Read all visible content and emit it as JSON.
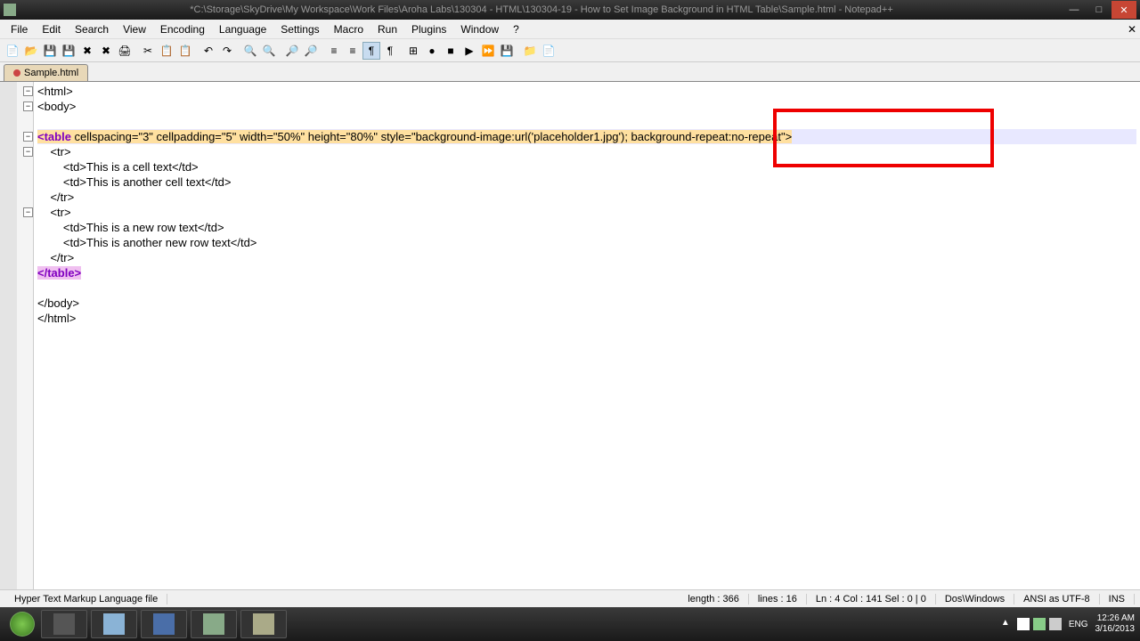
{
  "title": "*C:\\Storage\\SkyDrive\\My Workspace\\Work Files\\Aroha Labs\\130304 - HTML\\130304-19 - How to Set Image Background in HTML Table\\Sample.html - Notepad++",
  "menu": [
    "File",
    "Edit",
    "Search",
    "View",
    "Encoding",
    "Language",
    "Settings",
    "Macro",
    "Run",
    "Plugins",
    "Window",
    "?"
  ],
  "tab": {
    "label": "Sample.html"
  },
  "code": {
    "l1": "<html>",
    "l2": "<body>",
    "l3": "",
    "l4_tag": "<table",
    "l4_attrs": " cellspacing=\"3\" cellpadding=\"5\" width=\"50%\" height=\"80%\" style=\"background-image:url('placeholder1.jpg'); background-repeat:no-repeat\">",
    "l5": "    <tr>",
    "l6": "        <td>This is a cell text</td>",
    "l7": "        <td>This is another cell text</td>",
    "l8": "    </tr>",
    "l9": "    <tr>",
    "l10": "        <td>This is a new row text</td>",
    "l11": "        <td>This is another new row text</td>",
    "l12": "    </tr>",
    "l13": "</table>",
    "l14": "",
    "l15": "</body>",
    "l16": "</html>"
  },
  "status": {
    "filetype": "Hyper Text Markup Language file",
    "length": "length : 366",
    "lines": "lines : 16",
    "pos": "Ln : 4    Col : 141    Sel : 0 | 0",
    "eol": "Dos\\Windows",
    "encoding": "ANSI as UTF-8",
    "ins": "INS"
  },
  "tray": {
    "lang": "ENG",
    "time": "12:26 AM",
    "date": "3/16/2013"
  },
  "highlight_text": "background-repeat:no-repeat"
}
